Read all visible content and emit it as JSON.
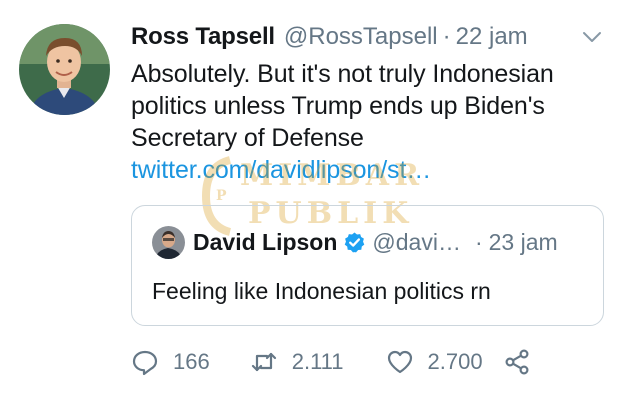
{
  "tweet": {
    "author_name": "Ross Tapsell",
    "author_handle": "@RossTapsell",
    "separator": "·",
    "time": "22 jam",
    "text_main": "Absolutely. But it's not truly Indonesian politics unless Trump ends up Biden's Secretary of Defense ",
    "link_text": "twitter.com/davidlipson/st…"
  },
  "quoted": {
    "author_name": "David Lipson",
    "author_handle": "@davi…",
    "separator": "·",
    "time": "23 jam",
    "text": "Feeling like Indonesian politics rn",
    "verified": true
  },
  "actions": {
    "replies": "166",
    "retweets": "2.111",
    "likes": "2.700"
  },
  "watermark": {
    "line1": "MIMBAR",
    "line2": "PUBLIK"
  },
  "colors": {
    "link": "#1b95e0",
    "muted": "#657786",
    "verified": "#1da1f2",
    "watermark": "#d89a18"
  },
  "icons": [
    "chevron-down-icon",
    "verified-badge-icon",
    "reply-icon",
    "retweet-icon",
    "like-icon",
    "share-icon"
  ]
}
